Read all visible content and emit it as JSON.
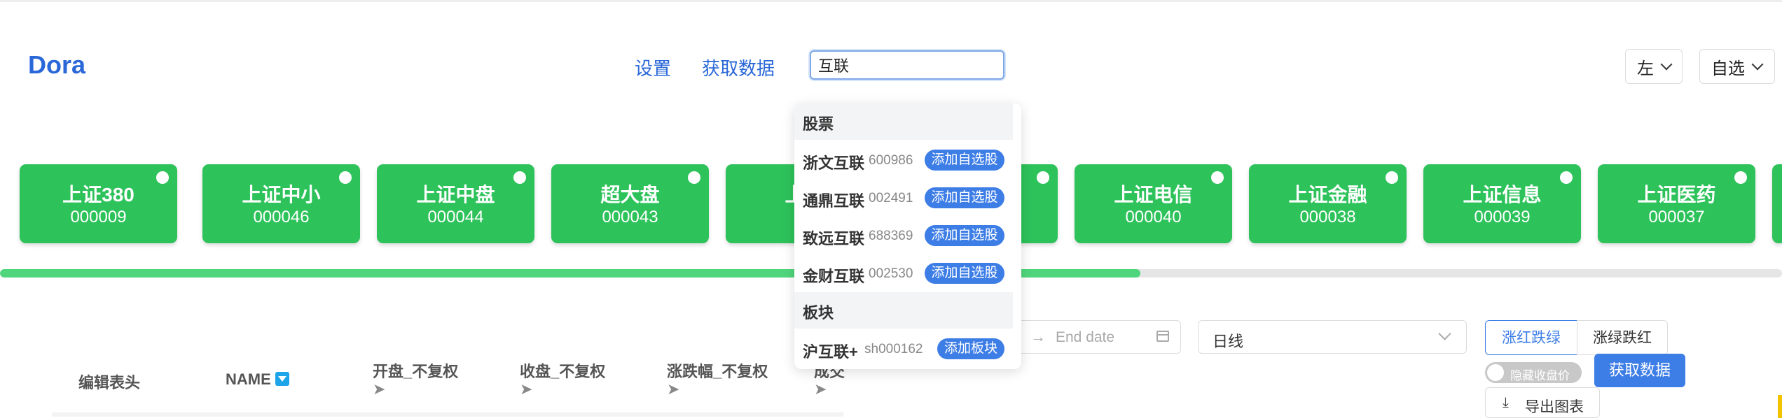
{
  "header": {
    "logo": "Dora",
    "nav": [
      {
        "label": "设置"
      },
      {
        "label": "获取数据"
      }
    ],
    "search": {
      "value": "互联"
    },
    "selects": [
      {
        "value": "左"
      },
      {
        "value": "自选"
      }
    ]
  },
  "index_cards": [
    {
      "name": "上证380",
      "code": "000009"
    },
    {
      "name": "上证中小",
      "code": "000046"
    },
    {
      "name": "上证中盘",
      "code": "000044"
    },
    {
      "name": "超大盘",
      "code": "000043"
    },
    {
      "name": "上证",
      "code": "00"
    },
    {
      "name": "",
      "code": ""
    },
    {
      "name": "上证电信",
      "code": "000040"
    },
    {
      "name": "上证金融",
      "code": "000038"
    },
    {
      "name": "上证信息",
      "code": "000039"
    },
    {
      "name": "上证医药",
      "code": "000037"
    }
  ],
  "progress": {
    "percent": 64
  },
  "table": {
    "headers": [
      {
        "label": "编辑表头"
      },
      {
        "label": "NAME"
      },
      {
        "label": "开盘_不复权"
      },
      {
        "label": "收盘_不复权"
      },
      {
        "label": "涨跌幅_不复权"
      },
      {
        "label": "成交"
      }
    ],
    "sort_icon": "sort-down-icon",
    "arrow_glyph": "➤"
  },
  "search_dropdown": {
    "groups": [
      {
        "title": "股票",
        "items": [
          {
            "name": "浙文互联",
            "code": "600986",
            "action": "添加自选股"
          },
          {
            "name": "通鼎互联",
            "code": "002491",
            "action": "添加自选股"
          },
          {
            "name": "致远互联",
            "code": "688369",
            "action": "添加自选股"
          },
          {
            "name": "金财互联",
            "code": "002530",
            "action": "添加自选股"
          }
        ]
      },
      {
        "title": "板块",
        "items": [
          {
            "name": "沪互联+",
            "code": "sh000162",
            "action": "添加板块"
          }
        ]
      }
    ]
  },
  "controls": {
    "date_arrow": "→",
    "end_date_placeholder": "End date",
    "period": "日线",
    "color_modes": [
      {
        "label": "涨红跌绿",
        "active": true
      },
      {
        "label": "涨绿跌红",
        "active": false
      }
    ],
    "hide_close_label": "隐藏收盘价",
    "fetch_label": "获取数据",
    "export_label": "导出图表",
    "export_icon_glyph": "⤓"
  },
  "colors": {
    "accent": "#2a67d8",
    "card_green": "#2dc25a",
    "primary_button": "#3d7de6"
  }
}
